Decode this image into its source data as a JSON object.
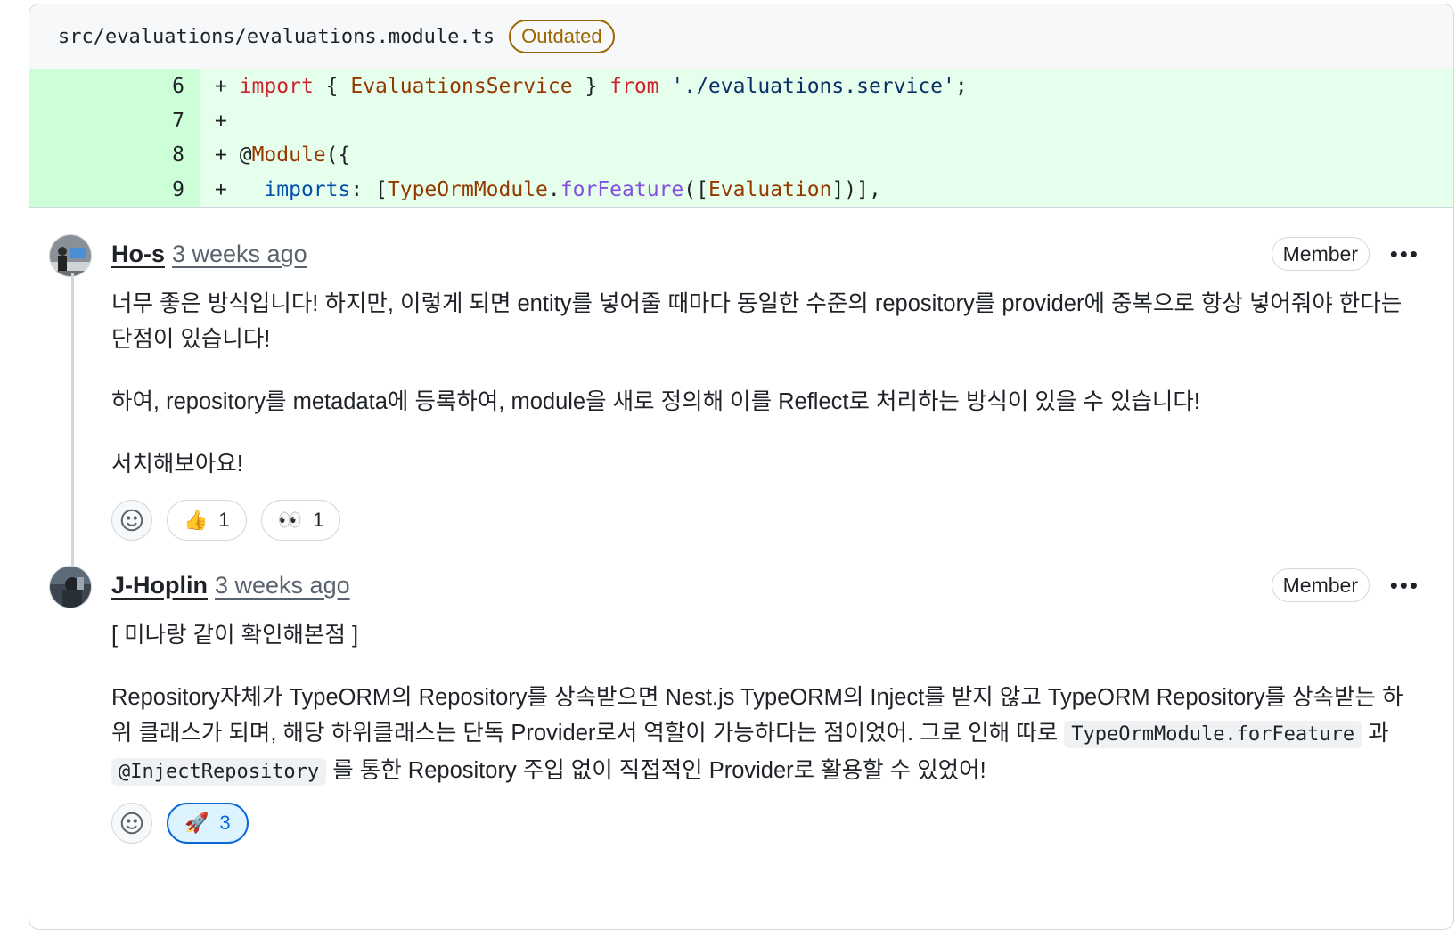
{
  "file": {
    "path": "src/evaluations/evaluations.module.ts",
    "badge": "Outdated"
  },
  "diff": {
    "lines": [
      {
        "num": "6",
        "prefix": "+ ",
        "tokens": [
          [
            "kw",
            "import"
          ],
          [
            "",
            " { "
          ],
          [
            "ty",
            "EvaluationsService"
          ],
          [
            "",
            " } "
          ],
          [
            "kw",
            "from"
          ],
          [
            "",
            " "
          ],
          [
            "str",
            "'./evaluations.service'"
          ],
          [
            "",
            ";"
          ]
        ]
      },
      {
        "num": "7",
        "prefix": "+ ",
        "tokens": []
      },
      {
        "num": "8",
        "prefix": "+ ",
        "tokens": [
          [
            "",
            "@"
          ],
          [
            "ty",
            "Module"
          ],
          [
            "",
            "({"
          ]
        ]
      },
      {
        "num": "9",
        "prefix": "+ ",
        "tokens": [
          [
            "",
            "  "
          ],
          [
            "prop",
            "imports"
          ],
          [
            "",
            ": ["
          ],
          [
            "ty",
            "TypeOrmModule"
          ],
          [
            "",
            "."
          ],
          [
            "fn",
            "forFeature"
          ],
          [
            "",
            "(["
          ],
          [
            "ty",
            "Evaluation"
          ],
          [
            "",
            "])],"
          ]
        ]
      }
    ]
  },
  "comments": [
    {
      "author": "Ho-s",
      "time": "3 weeks ago",
      "role": "Member",
      "more": "•••",
      "paragraphs": [
        "너무 좋은 방식입니다! 하지만, 이렇게 되면 entity를 넣어줄 때마다 동일한 수준의 repository를 provider에 중복으로 항상 넣어줘야 한다는 단점이 있습니다!",
        "하여, repository를 metadata에 등록하여, module을 새로 정의해 이를 Reflect로 처리하는 방식이 있을 수 있습니다!",
        "서치해보아요!"
      ],
      "reactions": [
        {
          "emoji": "👍",
          "count": "1"
        },
        {
          "emoji": "👀",
          "count": "1"
        }
      ]
    },
    {
      "author": "J-Hoplin",
      "time": "3 weeks ago",
      "role": "Member",
      "more": "•••",
      "p1": "[ 미나랑 같이 확인해본점 ]",
      "p2_text1": "Repository자체가 TypeORM의 Repository를 상속받으면 Nest.js TypeORM의 Inject를 받지 않고 TypeORM Repository를 상속받는 하위 클래스가 되며, 해당 하위클래스는 단독 Provider로서 역할이 가능하다는 점이었어. 그로 인해 따로 ",
      "p2_code1": "TypeOrmModule.forFeature",
      "p2_text2": " 과 ",
      "p2_code2": "@InjectRepository",
      "p2_text3": " 를 통한 Repository 주입 없이 직접적인 Provider로 활용할 수 있었어!",
      "reactions": [
        {
          "emoji": "🚀",
          "count": "3",
          "active": true
        }
      ]
    }
  ],
  "colors": {
    "accent": "#0969da",
    "add_gutter": "#ccffd8",
    "add_line": "#e6ffec",
    "outdated": "#9a6700"
  },
  "icons": [
    "smiley-icon",
    "kebab-horizontal-icon"
  ]
}
